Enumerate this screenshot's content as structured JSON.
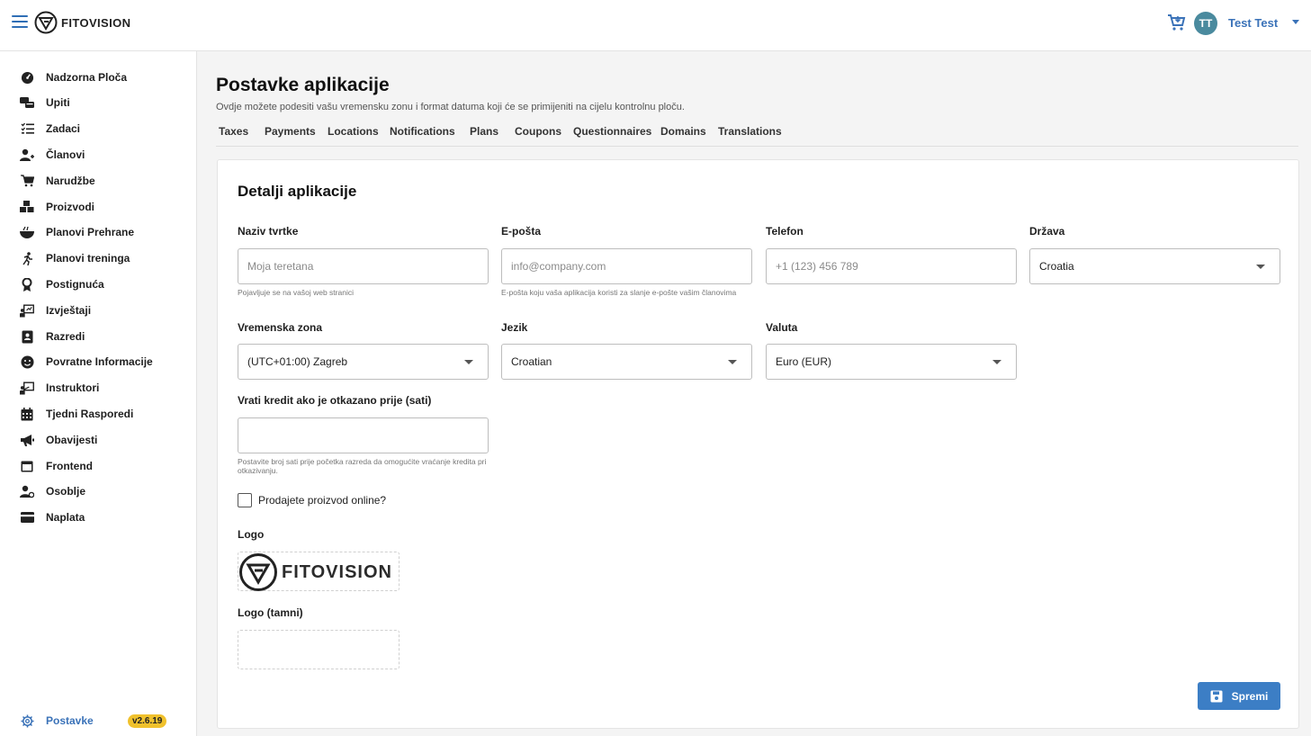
{
  "header": {
    "brand": "FITOVISION",
    "user_initials": "TT",
    "user_name": "Test Test"
  },
  "sidebar": {
    "items": [
      {
        "label": "Nadzorna Ploča",
        "icon": "speedometer-icon"
      },
      {
        "label": "Upiti",
        "icon": "chat-bubbles-icon"
      },
      {
        "label": "Zadaci",
        "icon": "checklist-icon"
      },
      {
        "label": "Članovi",
        "icon": "members-icon"
      },
      {
        "label": "Narudžbe",
        "icon": "cart-icon"
      },
      {
        "label": "Proizvodi",
        "icon": "boxes-icon"
      },
      {
        "label": "Planovi Prehrane",
        "icon": "bowl-icon"
      },
      {
        "label": "Planovi treninga",
        "icon": "running-icon"
      },
      {
        "label": "Postignuća",
        "icon": "medal-icon"
      },
      {
        "label": "Izvještaji",
        "icon": "presentation-chart-icon"
      },
      {
        "label": "Razredi",
        "icon": "book-icon"
      },
      {
        "label": "Povratne Informacije",
        "icon": "smiley-icon"
      },
      {
        "label": "Instruktori",
        "icon": "instructor-icon"
      },
      {
        "label": "Tjedni Rasporedi",
        "icon": "calendar-icon"
      },
      {
        "label": "Obavijesti",
        "icon": "megaphone-icon"
      },
      {
        "label": "Frontend",
        "icon": "window-icon"
      },
      {
        "label": "Osoblje",
        "icon": "staff-icon"
      },
      {
        "label": "Naplata",
        "icon": "credit-card-icon"
      }
    ],
    "settings_label": "Postavke",
    "version": "v2.6.19"
  },
  "page": {
    "title": "Postavke aplikacije",
    "subtitle": "Ovdje možete podesiti vašu vremensku zonu i format datuma koji će se primijeniti na cijelu kontrolnu ploču.",
    "tabs": [
      "Taxes",
      "Payments",
      "Locations",
      "Notifications",
      "Plans",
      "Coupons",
      "Questionnaires",
      "Domains",
      "Translations"
    ]
  },
  "form": {
    "section_title": "Detalji aplikacije",
    "company_name": {
      "label": "Naziv tvrtke",
      "placeholder": "Moja teretana",
      "value": "",
      "help": "Pojavljuje se na vašoj web stranici"
    },
    "email": {
      "label": "E-pošta",
      "placeholder": "info@company.com",
      "value": "",
      "help": "E-pošta koju vaša aplikacija koristi za slanje e-pošte vašim članovima"
    },
    "phone": {
      "label": "Telefon",
      "placeholder": "+1 (123) 456 789",
      "value": ""
    },
    "country": {
      "label": "Država",
      "value": "Croatia"
    },
    "timezone": {
      "label": "Vremenska zona",
      "value": "(UTC+01:00) Zagreb"
    },
    "language": {
      "label": "Jezik",
      "value": "Croatian"
    },
    "currency": {
      "label": "Valuta",
      "value": "Euro (EUR)"
    },
    "refund_hours": {
      "label": "Vrati kredit ako je otkazano prije (sati)",
      "value": "",
      "help": "Postavite broj sati prije početka razreda da omogućite vraćanje kredita pri otkazivanju."
    },
    "sell_online": {
      "label": "Prodajete proizvod online?",
      "checked": false
    },
    "logo": {
      "label": "Logo",
      "brand": "FITOVISION"
    },
    "logo_dark": {
      "label": "Logo (tamni)"
    },
    "save_label": "Spremi"
  },
  "colors": {
    "accent": "#3c7ec5",
    "badge": "#f0c12c",
    "avatar": "#4a8a9e"
  }
}
